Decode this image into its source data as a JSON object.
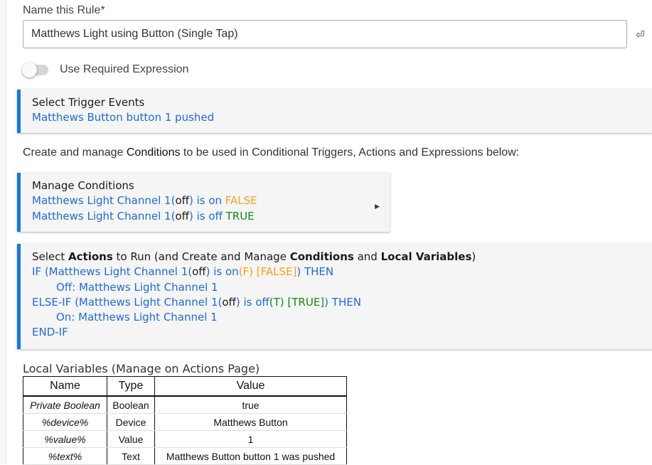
{
  "rule_name": {
    "label": "Name this Rule*",
    "value": "Matthews Light using Button (Single Tap)",
    "enter_icon": "⏎"
  },
  "required_expression": {
    "label": "Use Required Expression",
    "enabled": false
  },
  "trigger_panel": {
    "title": "Select Trigger Events",
    "line": "Matthews Button button 1 pushed"
  },
  "conditions_intro": {
    "before": "Create and manage ",
    "bold": "Conditions",
    "after": " to be used in Conditional Triggers, Actions and Expressions below:"
  },
  "conditions_panel": {
    "title": "Manage Conditions",
    "expand_icon": "▶",
    "conditions": [
      {
        "device": "Matthews Light Channel 1(",
        "state": "off",
        "test": ") is on ",
        "result": "FALSE"
      },
      {
        "device": "Matthews Light Channel 1(",
        "state": "off",
        "test": ") is off ",
        "result": "TRUE"
      }
    ]
  },
  "actions_panel": {
    "title_prefix": "Select ",
    "title_actions": "Actions",
    "title_middle": " to Run (and Create and Manage ",
    "title_conditions": "Conditions",
    "title_and": " and ",
    "title_local_variables": "Local Variables",
    "title_suffix": ")",
    "if_open": "IF (Matthews Light Channel 1(",
    "if_state": "off",
    "if_test": ") is on",
    "if_eval": "(F) [FALSE]",
    "if_close": ") THEN",
    "if_action": "Off: Matthews Light Channel 1",
    "elseif_open": "ELSE-IF (Matthews Light Channel 1(",
    "elseif_state": "off",
    "elseif_test": ") is off",
    "elseif_eval": "(T) [TRUE]",
    "elseif_close": ") THEN",
    "elseif_action": "On: Matthews Light Channel 1",
    "end": "END-IF"
  },
  "local_variables": {
    "title": "Local Variables",
    "subtitle": " (Manage on Actions Page)",
    "headers": {
      "name": "Name",
      "type": "Type",
      "value": "Value"
    },
    "rows": [
      {
        "name": "Private Boolean",
        "type": "Boolean",
        "value": "true"
      },
      {
        "name": "%device%",
        "type": "Device",
        "value": "Matthews Button"
      },
      {
        "name": "%value%",
        "type": "Value",
        "value": "1"
      },
      {
        "name": "%text%",
        "type": "Text",
        "value": "Matthews Button button 1 was pushed"
      }
    ]
  },
  "colors": {
    "accent": "#1a78d4",
    "link": "#1f6bd8",
    "false_status": "#f5a21b",
    "true_status": "#138a13"
  }
}
